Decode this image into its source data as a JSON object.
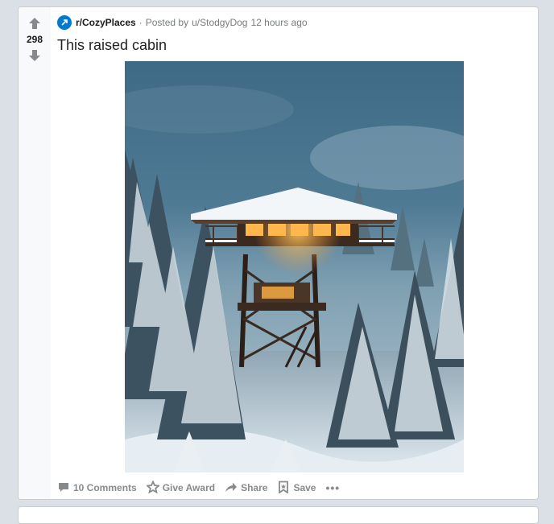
{
  "post": {
    "score": "298",
    "subreddit": "r/CozyPlaces",
    "posted_by_prefix": "Posted by",
    "author": "u/StodgyDog",
    "time": "12 hours ago",
    "title": "This raised cabin"
  },
  "actions": {
    "comments": "10 Comments",
    "award": "Give Award",
    "share": "Share",
    "save": "Save",
    "more": "•••"
  },
  "icons": {
    "upvote": "arrow-up-icon",
    "downvote": "arrow-down-icon",
    "subreddit": "subreddit-icon",
    "comments": "comment-icon",
    "award": "award-icon",
    "share": "share-icon",
    "save": "bookmark-icon",
    "more": "more-icon"
  },
  "colors": {
    "background": "#dae0e6",
    "card": "#ffffff",
    "vote_column": "#f8f9fa",
    "subreddit_icon": "#0079d3",
    "muted_text": "#878a8c"
  }
}
